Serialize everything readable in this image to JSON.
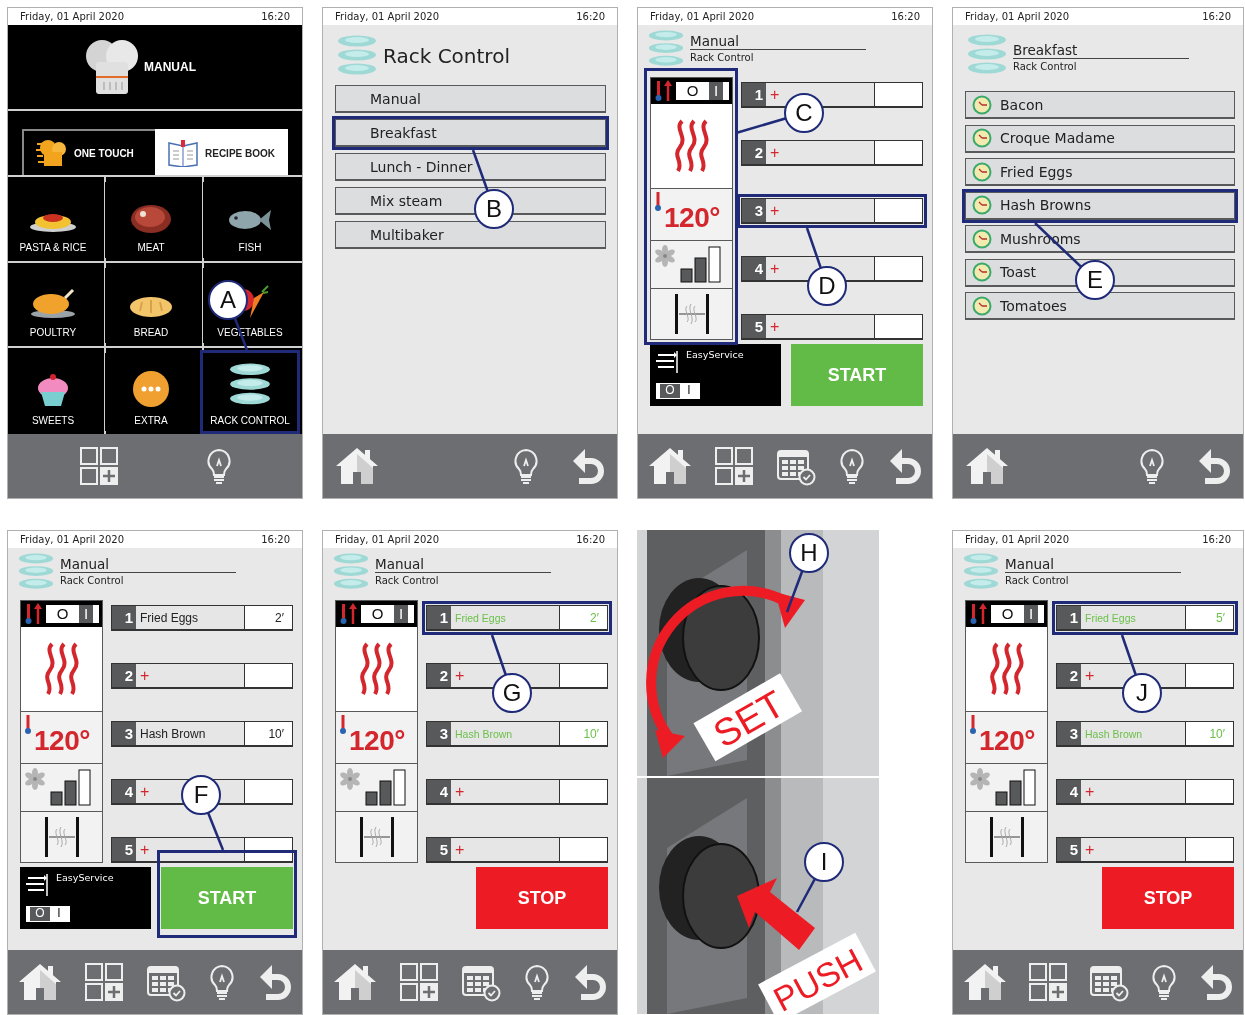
{
  "panels": [
    {
      "kind": "home",
      "status": {
        "date": "Friday, 01 April 2020",
        "time": "16:20"
      },
      "title": "MANUAL",
      "tabs": [
        {
          "label": "ONE TOUCH",
          "selected": false
        },
        {
          "label": "RECIPE BOOK",
          "selected": true
        }
      ],
      "categories": [
        {
          "label": "PASTA & RICE",
          "highlighted": false
        },
        {
          "label": "MEAT",
          "highlighted": false
        },
        {
          "label": "FISH",
          "highlighted": false
        },
        {
          "label": "POULTRY",
          "highlighted": false
        },
        {
          "label": "BREAD",
          "highlighted": false
        },
        {
          "label": "VEGETABLES",
          "highlighted": false
        },
        {
          "label": "SWEETS",
          "highlighted": false
        },
        {
          "label": "EXTRA",
          "highlighted": false
        },
        {
          "label": "RACK CONTROL",
          "highlighted": true,
          "callout": "A"
        }
      ]
    },
    {
      "kind": "menu",
      "status": {
        "date": "Friday, 01 April 2020",
        "time": "16:20"
      },
      "title": "Rack Control",
      "items": [
        {
          "label": "Manual",
          "highlighted": false
        },
        {
          "label": "Breakfast",
          "highlighted": true,
          "callout": "B"
        },
        {
          "label": "Lunch - Dinner",
          "highlighted": false
        },
        {
          "label": "Mix steam",
          "highlighted": false
        },
        {
          "label": "Multibaker",
          "highlighted": false
        }
      ]
    },
    {
      "kind": "rack",
      "status": {
        "date": "Friday, 01 April 2020",
        "time": "16:20"
      },
      "title": "Manual",
      "subtitle": "Rack Control",
      "controls": {
        "highlighted": true,
        "callout": "C",
        "switch": {
          "off_label": "O",
          "on_label": "I",
          "on": true
        },
        "temperature": "120°",
        "fan": {
          "level": 0.67
        }
      },
      "racks": [
        {
          "kind": "empty",
          "number": "1",
          "add": "+",
          "highlighted": false
        },
        {
          "kind": "empty",
          "number": "2",
          "add": "+",
          "highlighted": false
        },
        {
          "kind": "empty",
          "number": "3",
          "add": "+",
          "highlighted": true,
          "callout": "D"
        },
        {
          "kind": "empty",
          "number": "4",
          "add": "+",
          "highlighted": false
        },
        {
          "kind": "empty",
          "number": "5",
          "add": "+",
          "highlighted": false
        }
      ],
      "easy_service": {
        "label": "EasyService",
        "off_label": "O",
        "on_label": "I",
        "on": false
      },
      "action": {
        "kind": "start",
        "label": "START",
        "highlighted": false
      }
    },
    {
      "kind": "recipes",
      "status": {
        "date": "Friday, 01 April 2020",
        "time": "16:20"
      },
      "title": "Breakfast",
      "subtitle": "Rack Control",
      "items": [
        {
          "label": "Bacon",
          "highlighted": false
        },
        {
          "label": "Croque Madame",
          "highlighted": false
        },
        {
          "label": "Fried Eggs",
          "highlighted": false
        },
        {
          "label": "Hash Browns",
          "highlighted": true,
          "callout": "E"
        },
        {
          "label": "Mushrooms",
          "highlighted": false
        },
        {
          "label": "Toast",
          "highlighted": false
        },
        {
          "label": "Tomatoes",
          "highlighted": false
        }
      ]
    },
    {
      "kind": "rack",
      "status": {
        "date": "Friday, 01 April 2020",
        "time": "16:20"
      },
      "title": "Manual",
      "subtitle": "Rack Control",
      "controls": {
        "highlighted": false,
        "switch": {
          "off_label": "O",
          "on_label": "I",
          "on": true
        },
        "temperature": "120°",
        "fan": {
          "level": 0.67
        }
      },
      "racks": [
        {
          "kind": "recipe",
          "number": "1",
          "recipe": "Fried Eggs",
          "time": "2′",
          "running": false,
          "highlighted": false
        },
        {
          "kind": "empty",
          "number": "2",
          "add": "+",
          "highlighted": false
        },
        {
          "kind": "recipe",
          "number": "3",
          "recipe": "Hash Brown",
          "time": "10′",
          "running": false,
          "highlighted": false
        },
        {
          "kind": "empty",
          "number": "4",
          "add": "+",
          "highlighted": false
        },
        {
          "kind": "empty",
          "number": "5",
          "add": "+",
          "highlighted": false
        }
      ],
      "easy_service": {
        "label": "EasyService",
        "off_label": "O",
        "on_label": "I",
        "on": false
      },
      "action": {
        "kind": "start",
        "label": "START",
        "highlighted": true,
        "callout": "F"
      }
    },
    {
      "kind": "rack",
      "status": {
        "date": "Friday, 01 April 2020",
        "time": "16:20"
      },
      "title": "Manual",
      "subtitle": "Rack Control",
      "controls": {
        "highlighted": false,
        "switch": {
          "off_label": "O",
          "on_label": "I",
          "on": true
        },
        "temperature": "120°",
        "fan": {
          "level": 0.67
        }
      },
      "racks": [
        {
          "kind": "recipe",
          "number": "1",
          "recipe": "Fried Eggs",
          "time": "2′",
          "running": true,
          "highlighted": true,
          "callout": "G"
        },
        {
          "kind": "empty",
          "number": "2",
          "add": "+",
          "highlighted": false
        },
        {
          "kind": "recipe",
          "number": "3",
          "recipe": "Hash Brown",
          "time": "10′",
          "running": true,
          "highlighted": false
        },
        {
          "kind": "empty",
          "number": "4",
          "add": "+",
          "highlighted": false
        },
        {
          "kind": "empty",
          "number": "5",
          "add": "+",
          "highlighted": false
        }
      ],
      "action": {
        "kind": "stop",
        "label": "STOP",
        "highlighted": false
      }
    },
    {
      "kind": "knob",
      "steps": [
        {
          "label": "SET",
          "callout": "H"
        },
        {
          "label": "PUSH",
          "callout": "I"
        }
      ]
    },
    {
      "kind": "rack",
      "status": {
        "date": "Friday, 01 April 2020",
        "time": "16:20"
      },
      "title": "Manual",
      "subtitle": "Rack Control",
      "controls": {
        "highlighted": false,
        "switch": {
          "off_label": "O",
          "on_label": "I",
          "on": true
        },
        "temperature": "120°",
        "fan": {
          "level": 0.67
        }
      },
      "racks": [
        {
          "kind": "recipe",
          "number": "1",
          "recipe": "Fried Eggs",
          "time": "5′",
          "running": true,
          "highlighted": true,
          "callout": "J"
        },
        {
          "kind": "empty",
          "number": "2",
          "add": "+",
          "highlighted": false
        },
        {
          "kind": "recipe",
          "number": "3",
          "recipe": "Hash Brown",
          "time": "10′",
          "running": true,
          "highlighted": false
        },
        {
          "kind": "empty",
          "number": "4",
          "add": "+",
          "highlighted": false
        },
        {
          "kind": "empty",
          "number": "5",
          "add": "+",
          "highlighted": false
        }
      ],
      "action": {
        "kind": "stop",
        "label": "STOP",
        "highlighted": false
      }
    }
  ]
}
